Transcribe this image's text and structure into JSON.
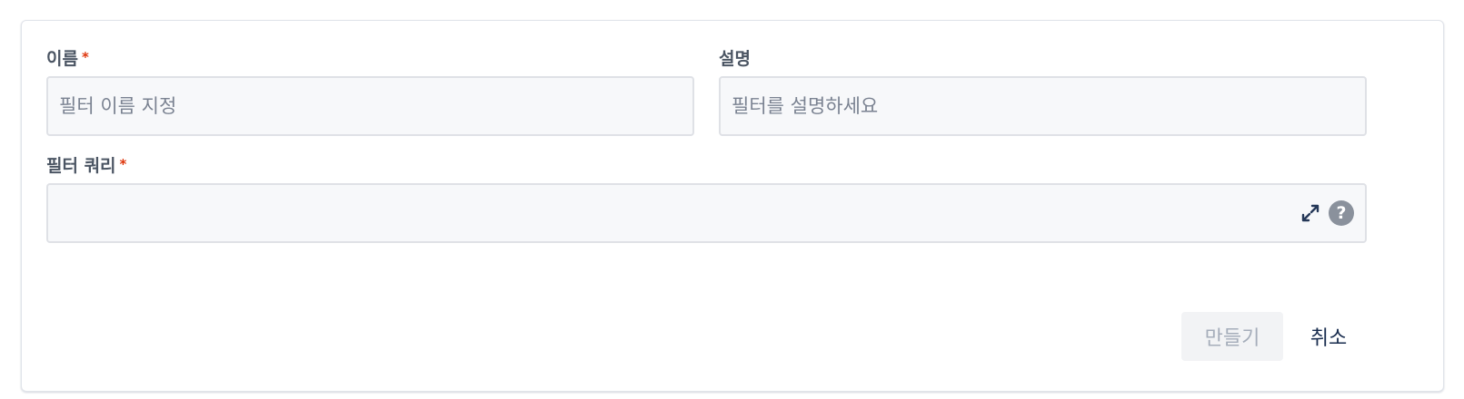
{
  "form": {
    "name": {
      "label": "이름",
      "required_mark": "*",
      "value": "",
      "placeholder": "필터 이름 지정"
    },
    "description": {
      "label": "설명",
      "value": "",
      "placeholder": "필터를 설명하세요"
    },
    "query": {
      "label": "필터 쿼리",
      "required_mark": "*",
      "value": "",
      "placeholder": "",
      "expand_icon": "expand-icon",
      "help_icon": "help-icon",
      "help_glyph": "?"
    }
  },
  "actions": {
    "create_label": "만들기",
    "create_enabled": false,
    "cancel_label": "취소"
  },
  "colors": {
    "required": "#de350b",
    "field_bg": "#f7f8fa",
    "field_border": "#dfe1e6",
    "disabled_text": "#a5adba"
  }
}
